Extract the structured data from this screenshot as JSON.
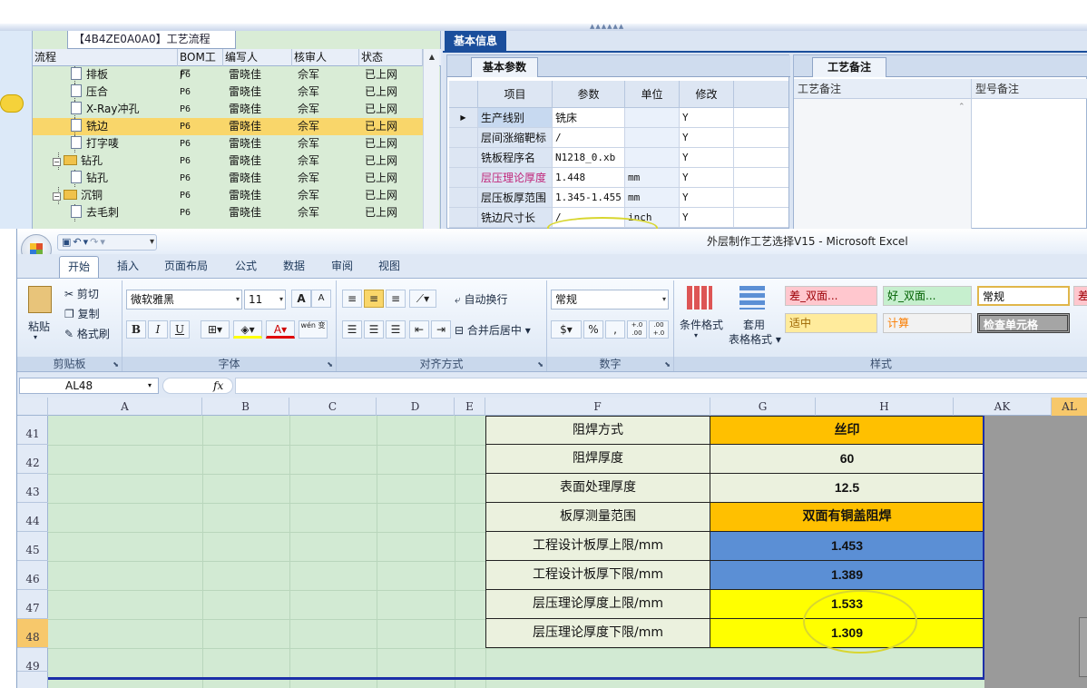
{
  "flow": {
    "tab_title": "【4B4ZE0A0A0】工艺流程",
    "columns": [
      "流程",
      "BOM工厂",
      "编写人",
      "核审人",
      "状态"
    ],
    "rows": [
      {
        "name": "排板",
        "bom": "P6",
        "writer": "雷晓佳",
        "reviewer": "佘军",
        "status": "已上网",
        "kind": "doc",
        "level": 2
      },
      {
        "name": "压合",
        "bom": "P6",
        "writer": "雷晓佳",
        "reviewer": "佘军",
        "status": "已上网",
        "kind": "doc",
        "level": 2
      },
      {
        "name": "X-Ray冲孔",
        "bom": "P6",
        "writer": "雷晓佳",
        "reviewer": "佘军",
        "status": "已上网",
        "kind": "doc",
        "level": 2
      },
      {
        "name": "铣边",
        "bom": "P6",
        "writer": "雷晓佳",
        "reviewer": "佘军",
        "status": "已上网",
        "kind": "doc",
        "level": 2,
        "selected": true
      },
      {
        "name": "打字唛",
        "bom": "P6",
        "writer": "雷晓佳",
        "reviewer": "佘军",
        "status": "已上网",
        "kind": "doc",
        "level": 2
      },
      {
        "name": "钻孔",
        "bom": "P6",
        "writer": "雷晓佳",
        "reviewer": "佘军",
        "status": "已上网",
        "kind": "folder",
        "level": 1
      },
      {
        "name": "钻孔",
        "bom": "P6",
        "writer": "雷晓佳",
        "reviewer": "佘军",
        "status": "已上网",
        "kind": "doc",
        "level": 2
      },
      {
        "name": "沉铜",
        "bom": "P6",
        "writer": "雷晓佳",
        "reviewer": "佘军",
        "status": "已上网",
        "kind": "folder",
        "level": 1
      },
      {
        "name": "去毛刺",
        "bom": "P6",
        "writer": "雷晓佳",
        "reviewer": "佘军",
        "status": "已上网",
        "kind": "doc",
        "level": 2
      }
    ]
  },
  "info": {
    "tab_title": "基本信息",
    "params_tab": "基本参数",
    "remarks_tab": "工艺备注",
    "param_columns": [
      "项目",
      "参数",
      "单位",
      "修改"
    ],
    "params": [
      {
        "item": "生产线别",
        "value": "铣床",
        "unit": "",
        "modify": "Y",
        "current": true
      },
      {
        "item": "层间涨缩靶标",
        "value": "/",
        "unit": "",
        "modify": "Y"
      },
      {
        "item": "铣板程序名",
        "value": "N1218_0.xb",
        "unit": "",
        "modify": "Y"
      },
      {
        "item": "层压理论厚度",
        "value": "1.448",
        "unit": "mm",
        "modify": "Y",
        "pink": true
      },
      {
        "item": "层压板厚范围",
        "value": "1.345-1.455",
        "unit": "mm",
        "modify": "Y"
      },
      {
        "item": "铣边尺寸长",
        "value": "/",
        "unit": "inch",
        "modify": "Y"
      }
    ],
    "remark_columns": [
      "工艺备注",
      "型号备注"
    ]
  },
  "excel": {
    "title": "外层制作工艺选择V15 - Microsoft Excel",
    "qat_icons": [
      "save-icon",
      "undo-icon",
      "redo-icon"
    ],
    "tabs": [
      "开始",
      "插入",
      "页面布局",
      "公式",
      "数据",
      "审阅",
      "视图"
    ],
    "clipboard": {
      "label": "剪贴板",
      "paste": "粘贴",
      "cut": "剪切",
      "copy": "复制",
      "format_painter": "格式刷"
    },
    "font": {
      "label": "字体",
      "name": "微软雅黑",
      "size": "11",
      "grow": "A",
      "shrink": "A",
      "bold": "B",
      "italic": "I",
      "underline": "U",
      "font_color": "A",
      "phonetic": "wén 变"
    },
    "alignment": {
      "label": "对齐方式",
      "wrap": "自动换行",
      "merge": "合并后居中"
    },
    "number": {
      "label": "数字",
      "format": "常规",
      "percent": "%",
      "comma": ",",
      "inc_dec": "+.0 .00",
      "dec_dec": ".00 +.0"
    },
    "styles": {
      "label": "样式",
      "conditional": "条件格式",
      "table_format_1": "套用",
      "table_format_2": "表格格式",
      "gallery": [
        {
          "name": "差_双面...",
          "bg": "#ffc7ce",
          "fg": "#9c0006"
        },
        {
          "name": "好_双面...",
          "bg": "#c6efce",
          "fg": "#006100"
        },
        {
          "name": "常规",
          "bg": "#ffffff",
          "fg": "#000000"
        },
        {
          "name": "差",
          "bg": "#ffc7ce",
          "fg": "#9c0006"
        },
        {
          "name": "适中",
          "bg": "#ffeb9c",
          "fg": "#9c6500"
        },
        {
          "name": "计算",
          "bg": "#f2f2f2",
          "fg": "#fa7d00"
        },
        {
          "name": "检查单元格",
          "bg": "#a5a5a5",
          "fg": "#ffffff"
        }
      ]
    },
    "name_box": "AL48",
    "fx": "fx",
    "formula": "",
    "columns": [
      "A",
      "B",
      "C",
      "D",
      "E",
      "F",
      "G",
      "H",
      "AK",
      "AL"
    ],
    "rows": [
      "41",
      "42",
      "43",
      "44",
      "45",
      "46",
      "47",
      "48",
      "49"
    ],
    "active_row": "48",
    "active_col": "AL",
    "table": [
      {
        "label": "阻焊方式",
        "value": "丝印",
        "fill": "#ffc000"
      },
      {
        "label": "阻焊厚度",
        "value": "60",
        "fill": "#ebf1de"
      },
      {
        "label": "表面处理厚度",
        "value": "12.5",
        "fill": "#ebf1de"
      },
      {
        "label": "板厚测量范围",
        "value": "双面有铜盖阻焊",
        "fill": "#ffc000"
      },
      {
        "label": "工程设计板厚上限/mm",
        "value": "1.453",
        "fill": "#5b8fd5"
      },
      {
        "label": "工程设计板厚下限/mm",
        "value": "1.389",
        "fill": "#5b8fd5"
      },
      {
        "label": "层压理论厚度上限/mm",
        "value": "1.533",
        "fill": "#ffff00"
      },
      {
        "label": "层压理论厚度下限/mm",
        "value": "1.309",
        "fill": "#ffff00"
      }
    ]
  },
  "colors": {
    "accent": "#1a4e9c",
    "selected_row": "#f9d66a",
    "highlight_circle": "#d8d630"
  }
}
